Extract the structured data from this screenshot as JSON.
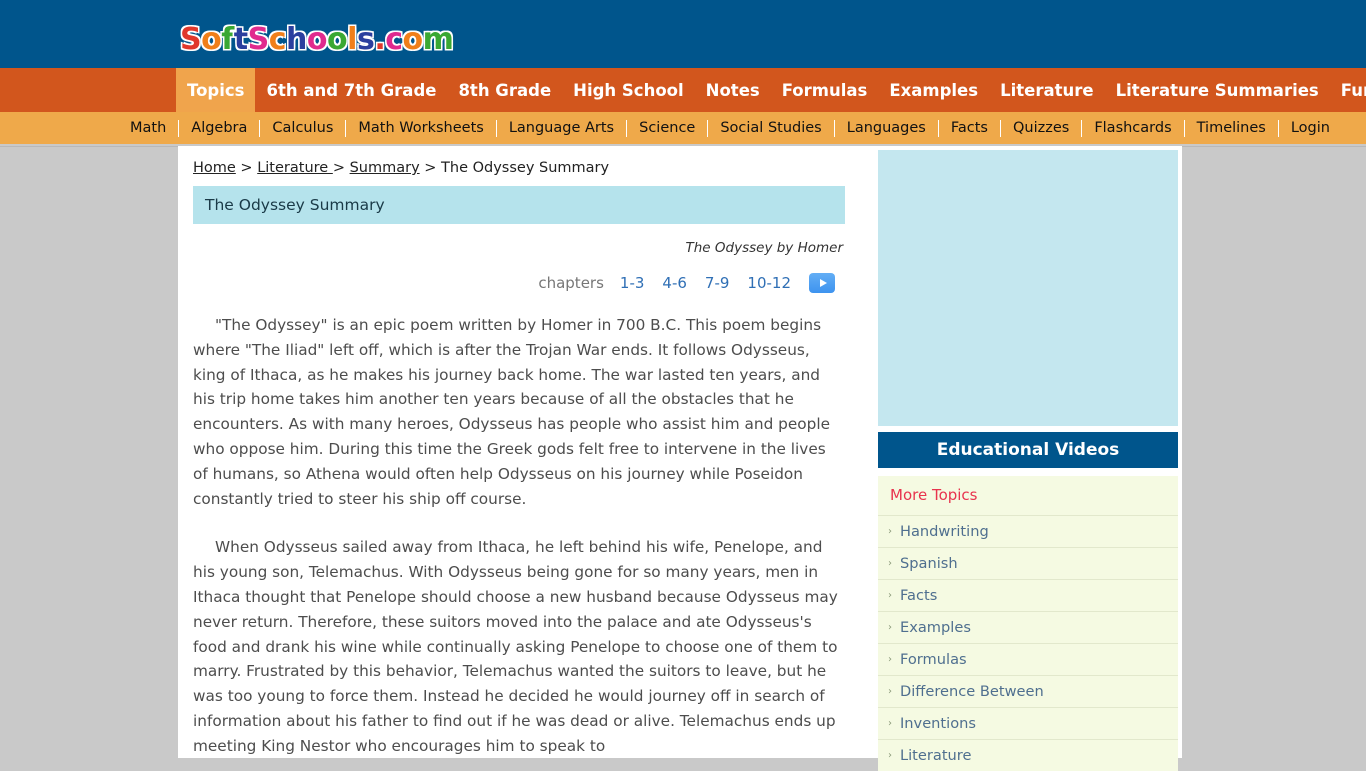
{
  "site": {
    "logo_letters": [
      {
        "ch": "S",
        "color": "#e0382c"
      },
      {
        "ch": "o",
        "color": "#f07f1a"
      },
      {
        "ch": "f",
        "color": "#3aa832"
      },
      {
        "ch": "t",
        "color": "#2b3f9e"
      },
      {
        "ch": "S",
        "color": "#e02a8e"
      },
      {
        "ch": "c",
        "color": "#f07f1a"
      },
      {
        "ch": "h",
        "color": "#2b3f9e"
      },
      {
        "ch": "o",
        "color": "#e02a8e"
      },
      {
        "ch": "o",
        "color": "#3aa832"
      },
      {
        "ch": "l",
        "color": "#f07f1a"
      },
      {
        "ch": "s",
        "color": "#2b3f9e"
      },
      {
        "ch": ".",
        "color": "#e0382c"
      },
      {
        "ch": "c",
        "color": "#e02a8e"
      },
      {
        "ch": "o",
        "color": "#f07f1a"
      },
      {
        "ch": "m",
        "color": "#3aa832"
      }
    ],
    "header_bg": "#00558c",
    "primary_nav_bg": "#d2561d",
    "primary_nav_active_bg": "#f0a44c",
    "secondary_nav_bg": "#efa94a"
  },
  "nav_primary": [
    {
      "label": "Topics",
      "active": true
    },
    {
      "label": "6th and 7th Grade",
      "active": false
    },
    {
      "label": "8th Grade",
      "active": false
    },
    {
      "label": "High School",
      "active": false
    },
    {
      "label": "Notes",
      "active": false
    },
    {
      "label": "Formulas",
      "active": false
    },
    {
      "label": "Examples",
      "active": false
    },
    {
      "label": "Literature",
      "active": false
    },
    {
      "label": "Literature Summaries",
      "active": false
    },
    {
      "label": "Fun Games",
      "active": false
    }
  ],
  "nav_secondary": [
    {
      "label": "Math"
    },
    {
      "label": "Algebra"
    },
    {
      "label": "Calculus"
    },
    {
      "label": "Math Worksheets"
    },
    {
      "label": "Language Arts"
    },
    {
      "label": "Science"
    },
    {
      "label": "Social Studies"
    },
    {
      "label": "Languages"
    },
    {
      "label": "Facts"
    },
    {
      "label": "Quizzes"
    },
    {
      "label": "Flashcards"
    },
    {
      "label": "Timelines"
    },
    {
      "label": "Login"
    }
  ],
  "breadcrumb": {
    "home": "Home",
    "sep1": " > ",
    "literature": "Literature ",
    "sep2": "> ",
    "summary": "Summary",
    "sep3": " > ",
    "current": "The Odyssey Summary"
  },
  "main": {
    "page_title": "The Odyssey Summary",
    "byline": "The Odyssey by Homer",
    "chapters_label": "chapters",
    "chapters": [
      {
        "label": "1-3"
      },
      {
        "label": "4-6"
      },
      {
        "label": "7-9"
      },
      {
        "label": "10-12"
      }
    ],
    "play_button_name": "play-audio-button",
    "paragraphs": [
      "\"The Odyssey\" is an epic poem written by Homer in 700 B.C. This poem begins where \"The Iliad\" left off, which is after the Trojan War ends. It follows Odysseus, king of Ithaca, as he makes his journey back home. The war lasted ten years, and his trip home takes him another ten years because of all the obstacles that he encounters. As with many heroes, Odysseus has people who assist him and people who oppose him. During this time the Greek gods felt free to intervene in the lives of humans, so Athena would often help Odysseus on his journey while Poseidon constantly tried to steer his ship off course.",
      "When Odysseus sailed away from Ithaca, he left behind his wife, Penelope, and his young son, Telemachus. With Odysseus being gone for so many years, men in Ithaca thought that Penelope should choose a new husband because Odysseus may never return. Therefore, these suitors moved into the palace and ate Odysseus's food and drank his wine while continually asking Penelope to choose one of them to marry. Frustrated by this behavior, Telemachus wanted the suitors to leave, but he was too young to force them. Instead he decided he would journey off in search of information about his father to find out if he was dead or alive. Telemachus ends up meeting King Nestor who encourages him to speak to"
    ]
  },
  "rail": {
    "videos_heading": "Educational Videos",
    "more_topics_title": "More Topics",
    "topics": [
      {
        "label": "Handwriting"
      },
      {
        "label": "Spanish"
      },
      {
        "label": "Facts"
      },
      {
        "label": "Examples"
      },
      {
        "label": "Formulas"
      },
      {
        "label": "Difference Between"
      },
      {
        "label": "Inventions"
      },
      {
        "label": "Literature"
      }
    ]
  }
}
